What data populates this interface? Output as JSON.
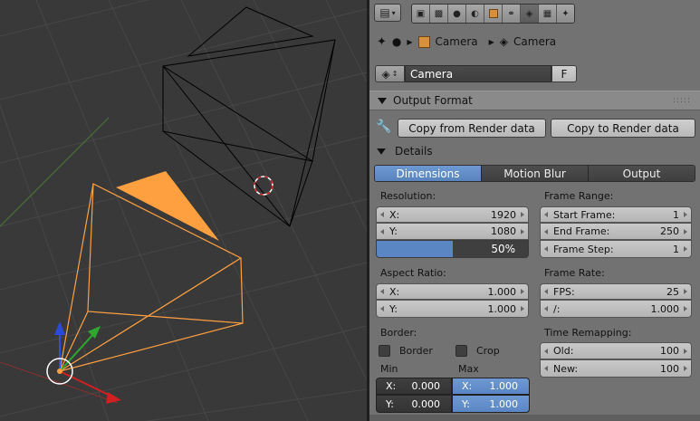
{
  "toolbar": {
    "icons": [
      "render-icon",
      "render-layers-icon",
      "scene-icon",
      "world-icon",
      "object-icon",
      "constraints-icon",
      "camera-data-icon",
      "texture-icon",
      "particles-icon"
    ],
    "active": "camera-data-icon"
  },
  "breadcrumb": {
    "items": [
      {
        "icon": "object-cube-icon",
        "label": "Camera"
      },
      {
        "icon": "camera-data-icon",
        "label": "Camera"
      }
    ]
  },
  "datablock": {
    "name": "Camera",
    "fake_user_label": "F"
  },
  "output_format": {
    "title": "Output Format",
    "copy_from_label": "Copy from Render data",
    "copy_to_label": "Copy to Render data",
    "details_label": "Details",
    "tabs": [
      {
        "label": "Dimensions",
        "active": true
      },
      {
        "label": "Motion Blur",
        "active": false
      },
      {
        "label": "Output",
        "active": false
      }
    ],
    "resolution": {
      "title": "Resolution:",
      "x_label": "X:",
      "x_value": "1920",
      "y_label": "Y:",
      "y_value": "1080",
      "percent": 50,
      "percent_label": "50%"
    },
    "frame_range": {
      "title": "Frame Range:",
      "start_label": "Start Frame:",
      "start_value": "1",
      "end_label": "End Frame:",
      "end_value": "250",
      "step_label": "Frame Step:",
      "step_value": "1"
    },
    "aspect_ratio": {
      "title": "Aspect Ratio:",
      "x_label": "X:",
      "x_value": "1.000",
      "y_label": "Y:",
      "y_value": "1.000"
    },
    "frame_rate": {
      "title": "Frame Rate:",
      "fps_label": "FPS:",
      "fps_value": "25",
      "base_label": "/:",
      "base_value": "1.000"
    },
    "border": {
      "title": "Border:",
      "border_label": "Border",
      "crop_label": "Crop",
      "min_label": "Min",
      "max_label": "Max",
      "min_x_label": "X:",
      "min_x_value": "0.000",
      "min_y_label": "Y:",
      "min_y_value": "0.000",
      "max_x_label": "X:",
      "max_x_value": "1.000",
      "max_y_label": "Y:",
      "max_y_value": "1.000"
    },
    "time_remapping": {
      "title": "Time Remapping:",
      "old_label": "Old:",
      "old_value": "100",
      "new_label": "New:",
      "new_value": "100"
    }
  },
  "colors": {
    "selected_blue": "#5a86c4",
    "camera_orange": "#ffa040",
    "viewport_bg": "#393939",
    "panel_bg": "#727272"
  }
}
